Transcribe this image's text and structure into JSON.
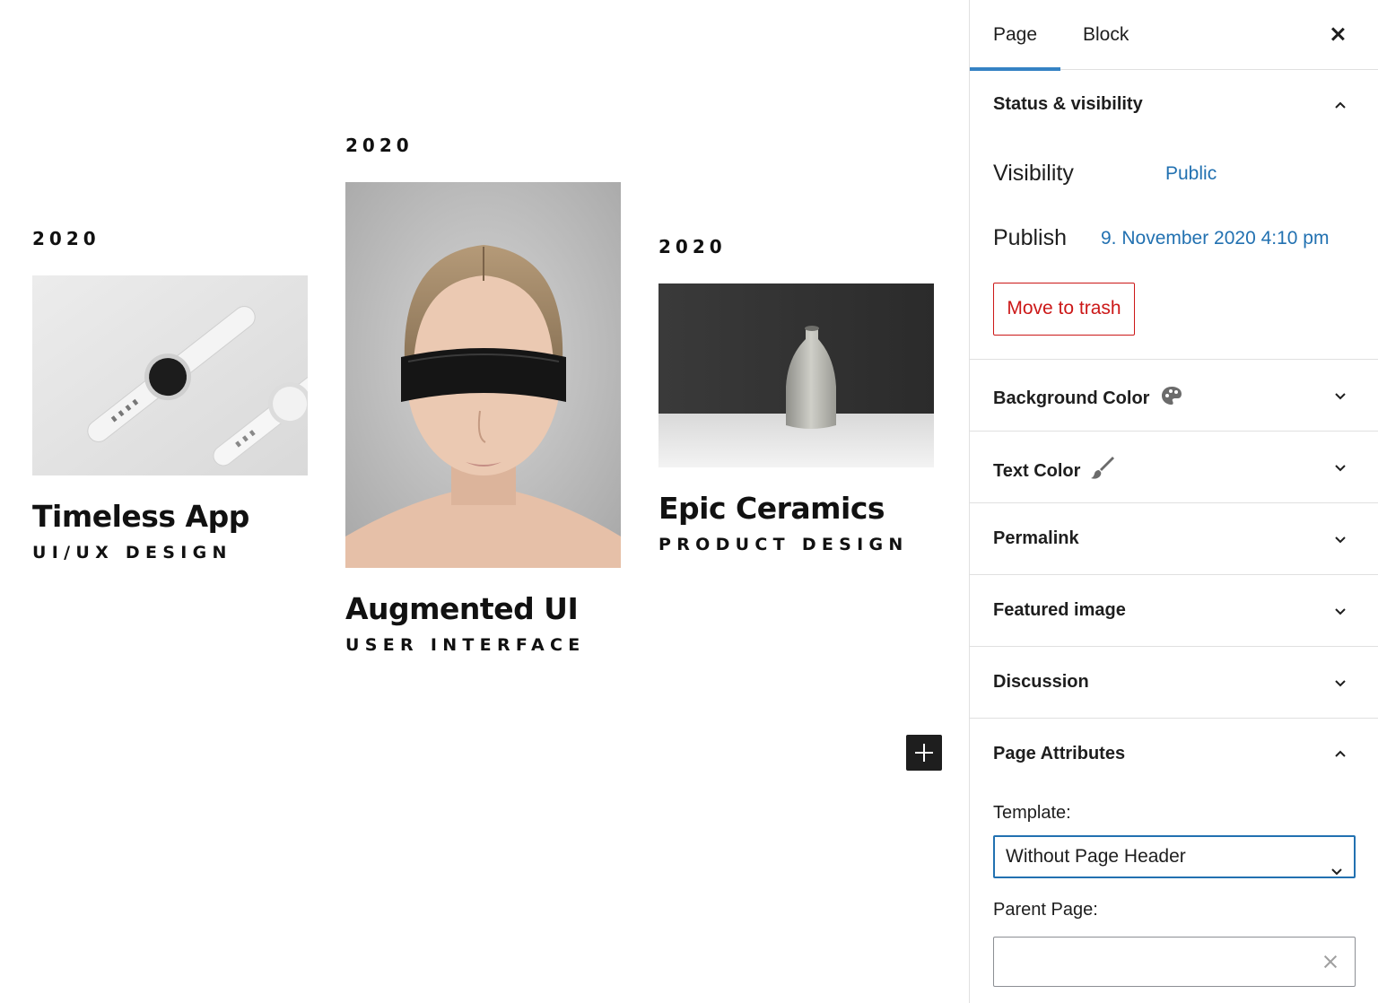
{
  "canvas": {
    "cards": [
      {
        "year": "2020",
        "title": "Timeless App",
        "subtitle": "UI/UX DESIGN",
        "image": "smartwatch-photo"
      },
      {
        "year": "2020",
        "title": "Augmented UI",
        "subtitle": "USER INTERFACE",
        "image": "woman-vr-headband-photo"
      },
      {
        "year": "2020",
        "title": "Epic Ceramics",
        "subtitle": "PRODUCT DESIGN",
        "image": "ceramic-vase-photo"
      }
    ],
    "add_block_icon": "plus-icon"
  },
  "sidebar": {
    "tabs": {
      "page": "Page",
      "block": "Block"
    },
    "close_icon": "close-icon",
    "status": {
      "title": "Status & visibility",
      "visibility_label": "Visibility",
      "visibility_value": "Public",
      "publish_label": "Publish",
      "publish_value": "9. November 2020 4:10 pm",
      "trash_label": "Move to trash"
    },
    "panels": {
      "background_color": "Background Color",
      "text_color": "Text Color",
      "permalink": "Permalink",
      "featured_image": "Featured image",
      "discussion": "Discussion",
      "page_attributes": "Page Attributes"
    },
    "attributes": {
      "template_label": "Template:",
      "template_value": "Without Page Header",
      "parent_label": "Parent Page:",
      "parent_value": ""
    }
  },
  "colors": {
    "accent": "#3582c4",
    "link": "#2271b1",
    "danger": "#cc1818"
  }
}
